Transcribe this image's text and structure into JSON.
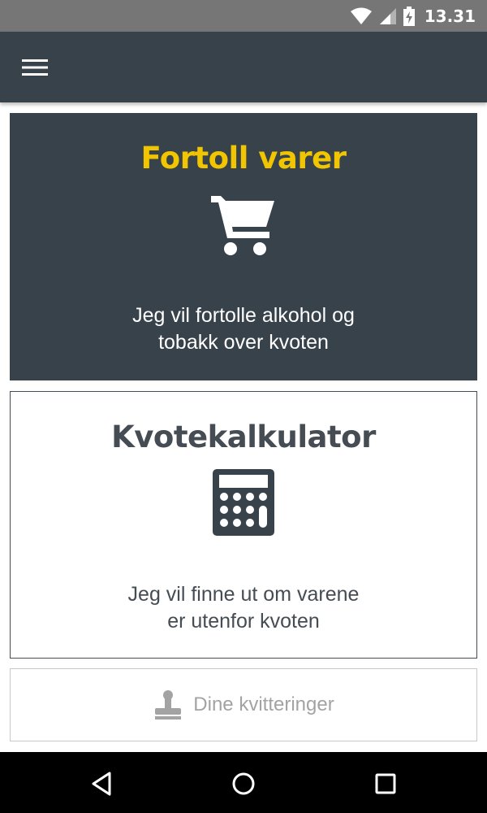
{
  "status_bar": {
    "time": "13.31",
    "icons": [
      "wifi-icon",
      "signal-icon",
      "battery-charging-icon"
    ]
  },
  "app_bar": {
    "menu_icon": "hamburger-menu-icon"
  },
  "cards": [
    {
      "title": "Fortoll varer",
      "icon": "shopping-cart-icon",
      "description_line1": "Jeg vil fortolle alkohol og",
      "description_line2": "tobakk over kvoten"
    },
    {
      "title": "Kvotekalkulator",
      "icon": "calculator-icon",
      "description_line1": "Jeg vil finne ut om varene",
      "description_line2": "er utenfor kvoten"
    }
  ],
  "receipts_button": {
    "label": "Dine kvitteringer",
    "icon": "stamp-icon"
  },
  "nav_bar": {
    "icons": [
      "back-icon",
      "home-icon",
      "recents-icon"
    ]
  },
  "colors": {
    "dark": "#38424b",
    "accent": "#f1c500",
    "muted": "#a3a3a3"
  }
}
